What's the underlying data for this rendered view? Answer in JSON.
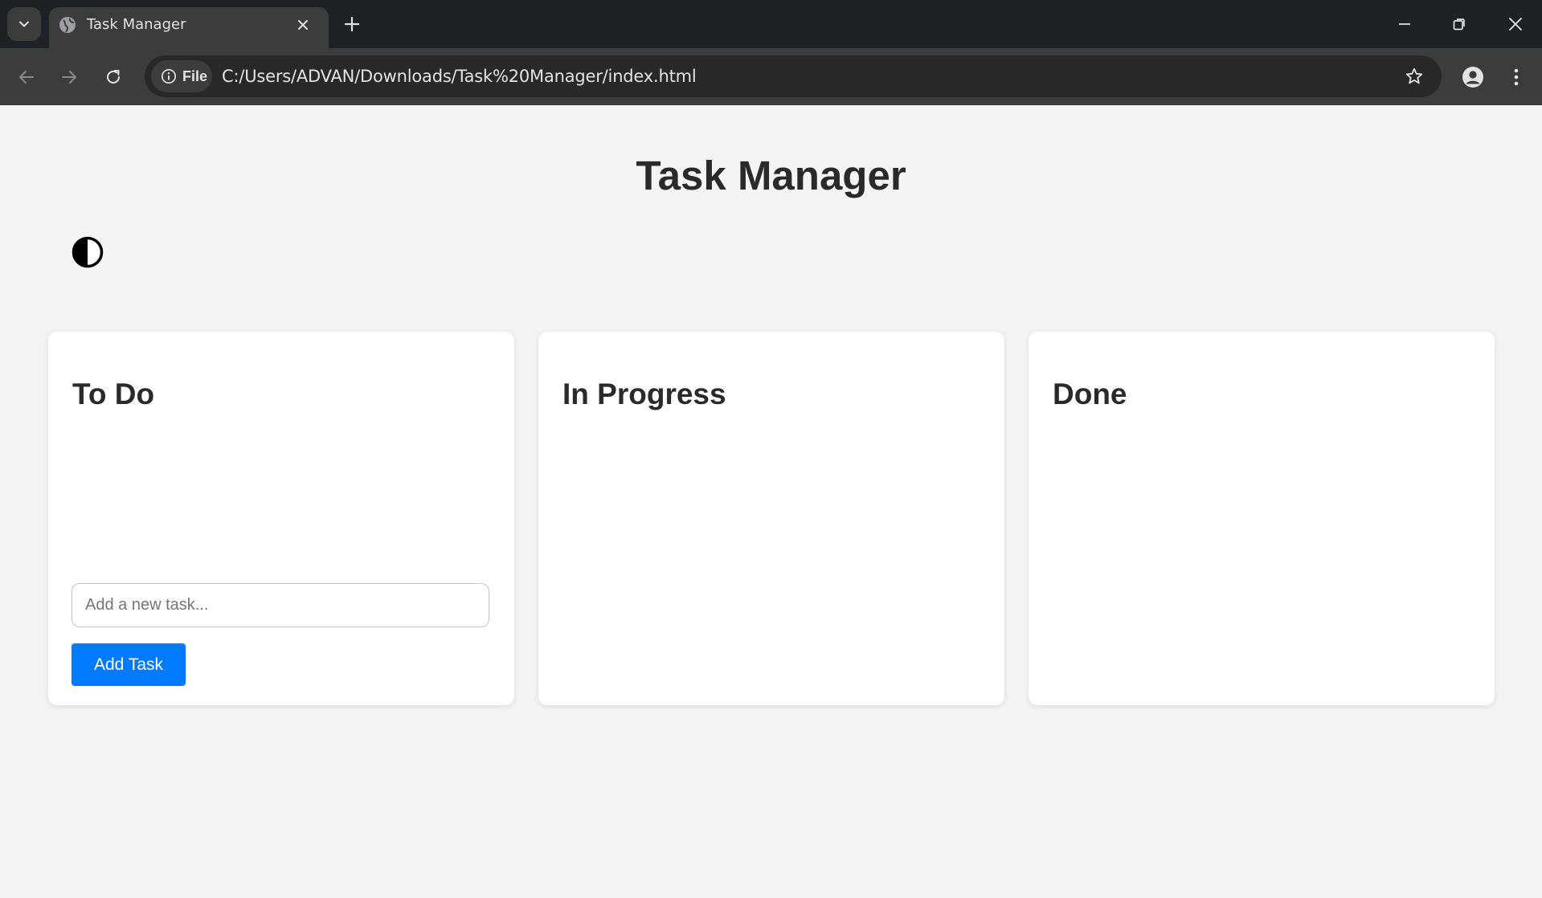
{
  "browser": {
    "tab_title": "Task Manager",
    "security_chip_label": "File",
    "url": "C:/Users/ADVAN/Downloads/Task%20Manager/index.html"
  },
  "page": {
    "title": "Task Manager",
    "theme_toggle_icon": "half-circle-contrast-icon"
  },
  "columns": [
    {
      "title": "To Do"
    },
    {
      "title": "In Progress"
    },
    {
      "title": "Done"
    }
  ],
  "add_task": {
    "placeholder": "Add a new task...",
    "value": "",
    "button_label": "Add Task"
  },
  "colors": {
    "accent": "#007bff",
    "page_background": "#f4f4f4",
    "card_background": "#ffffff"
  }
}
